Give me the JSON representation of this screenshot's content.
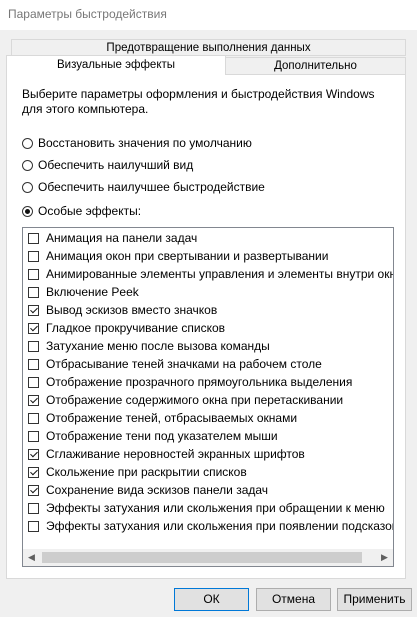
{
  "window": {
    "title": "Параметры быстродействия"
  },
  "tabs": {
    "top_row": "Предотвращение выполнения данных",
    "visual": "Визуальные эффекты",
    "advanced": "Дополнительно"
  },
  "description": "Выберите параметры оформления и быстродействия Windows для этого компьютера.",
  "options": [
    {
      "label": "Восстановить значения по умолчанию",
      "selected": false
    },
    {
      "label": "Обеспечить наилучший вид",
      "selected": false
    },
    {
      "label": "Обеспечить наилучшее быстродействие",
      "selected": false
    },
    {
      "label": "Особые эффекты:",
      "selected": true
    }
  ],
  "effects": [
    {
      "label": "Анимация на панели задач",
      "checked": false
    },
    {
      "label": "Анимация окон при свертывании и развертывании",
      "checked": false
    },
    {
      "label": "Анимированные элементы управления и элементы внутри окна",
      "checked": false
    },
    {
      "label": "Включение Peek",
      "checked": false
    },
    {
      "label": "Вывод эскизов вместо значков",
      "checked": true
    },
    {
      "label": "Гладкое прокручивание списков",
      "checked": true
    },
    {
      "label": "Затухание меню после вызова команды",
      "checked": false
    },
    {
      "label": "Отбрасывание теней значками на рабочем столе",
      "checked": false
    },
    {
      "label": "Отображение прозрачного прямоугольника выделения",
      "checked": false
    },
    {
      "label": "Отображение содержимого окна при перетаскивании",
      "checked": true
    },
    {
      "label": "Отображение теней, отбрасываемых окнами",
      "checked": false
    },
    {
      "label": "Отображение тени под указателем мыши",
      "checked": false
    },
    {
      "label": "Сглаживание неровностей экранных шрифтов",
      "checked": true
    },
    {
      "label": "Скольжение при раскрытии списков",
      "checked": true
    },
    {
      "label": "Сохранение вида эскизов панели задач",
      "checked": true
    },
    {
      "label": "Эффекты затухания или скольжения при обращении к меню",
      "checked": false
    },
    {
      "label": "Эффекты затухания или скольжения при появлении подсказок",
      "checked": false
    }
  ],
  "buttons": {
    "ok": "ОК",
    "cancel": "Отмена",
    "apply": "Применить"
  },
  "colors": {
    "accent_border": "#0078d7",
    "dialog_bg": "#f0f0f0"
  }
}
